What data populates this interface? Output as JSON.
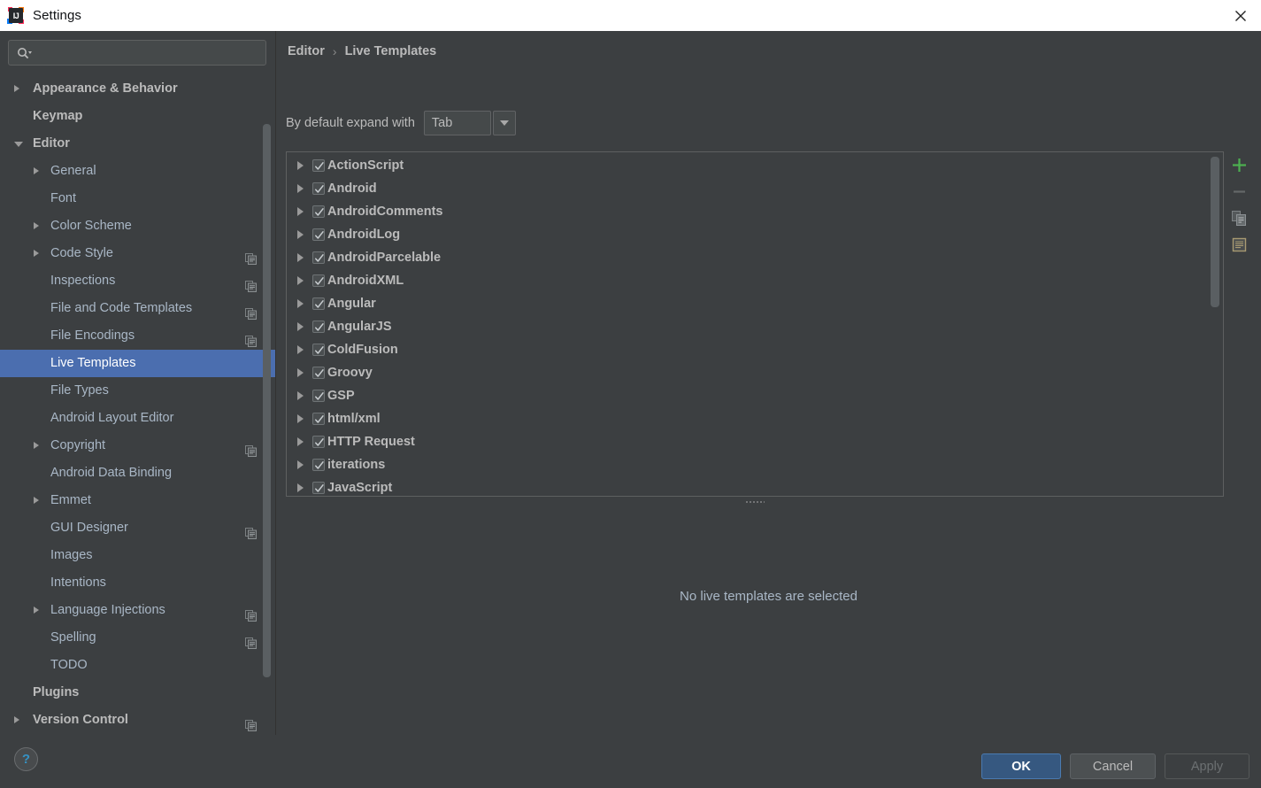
{
  "window": {
    "title": "Settings",
    "app_icon": "intellij-idea-logo",
    "icon_letters": "IJ",
    "close_icon": "close-icon"
  },
  "search": {
    "value": "",
    "placeholder": "",
    "icon": "search-icon"
  },
  "sidebar": {
    "items": [
      {
        "label": "Appearance & Behavior",
        "level": 0,
        "arrow": "collapsed",
        "bold": true,
        "copy_icon": false,
        "selected": false
      },
      {
        "label": "Keymap",
        "level": 0,
        "arrow": "none",
        "bold": true,
        "copy_icon": false,
        "selected": false
      },
      {
        "label": "Editor",
        "level": 0,
        "arrow": "expanded",
        "bold": true,
        "copy_icon": false,
        "selected": false
      },
      {
        "label": "General",
        "level": 1,
        "arrow": "collapsed",
        "bold": false,
        "copy_icon": false,
        "selected": false
      },
      {
        "label": "Font",
        "level": 1,
        "arrow": "none",
        "bold": false,
        "copy_icon": false,
        "selected": false
      },
      {
        "label": "Color Scheme",
        "level": 1,
        "arrow": "collapsed",
        "bold": false,
        "copy_icon": false,
        "selected": false
      },
      {
        "label": "Code Style",
        "level": 1,
        "arrow": "collapsed",
        "bold": false,
        "copy_icon": true,
        "selected": false
      },
      {
        "label": "Inspections",
        "level": 1,
        "arrow": "none",
        "bold": false,
        "copy_icon": true,
        "selected": false
      },
      {
        "label": "File and Code Templates",
        "level": 1,
        "arrow": "none",
        "bold": false,
        "copy_icon": true,
        "selected": false
      },
      {
        "label": "File Encodings",
        "level": 1,
        "arrow": "none",
        "bold": false,
        "copy_icon": true,
        "selected": false
      },
      {
        "label": "Live Templates",
        "level": 1,
        "arrow": "none",
        "bold": false,
        "copy_icon": false,
        "selected": true
      },
      {
        "label": "File Types",
        "level": 1,
        "arrow": "none",
        "bold": false,
        "copy_icon": false,
        "selected": false
      },
      {
        "label": "Android Layout Editor",
        "level": 1,
        "arrow": "none",
        "bold": false,
        "copy_icon": false,
        "selected": false
      },
      {
        "label": "Copyright",
        "level": 1,
        "arrow": "collapsed",
        "bold": false,
        "copy_icon": true,
        "selected": false
      },
      {
        "label": "Android Data Binding",
        "level": 1,
        "arrow": "none",
        "bold": false,
        "copy_icon": false,
        "selected": false
      },
      {
        "label": "Emmet",
        "level": 1,
        "arrow": "collapsed",
        "bold": false,
        "copy_icon": false,
        "selected": false
      },
      {
        "label": "GUI Designer",
        "level": 1,
        "arrow": "none",
        "bold": false,
        "copy_icon": true,
        "selected": false
      },
      {
        "label": "Images",
        "level": 1,
        "arrow": "none",
        "bold": false,
        "copy_icon": false,
        "selected": false
      },
      {
        "label": "Intentions",
        "level": 1,
        "arrow": "none",
        "bold": false,
        "copy_icon": false,
        "selected": false
      },
      {
        "label": "Language Injections",
        "level": 1,
        "arrow": "collapsed",
        "bold": false,
        "copy_icon": true,
        "selected": false
      },
      {
        "label": "Spelling",
        "level": 1,
        "arrow": "none",
        "bold": false,
        "copy_icon": true,
        "selected": false
      },
      {
        "label": "TODO",
        "level": 1,
        "arrow": "none",
        "bold": false,
        "copy_icon": false,
        "selected": false
      },
      {
        "label": "Plugins",
        "level": 0,
        "arrow": "none",
        "bold": true,
        "copy_icon": false,
        "selected": false
      },
      {
        "label": "Version Control",
        "level": 0,
        "arrow": "collapsed",
        "bold": true,
        "copy_icon": true,
        "selected": false
      }
    ]
  },
  "breadcrumb": {
    "parent": "Editor",
    "separator": "›",
    "current": "Live Templates"
  },
  "expand_with": {
    "label": "By default expand with",
    "value": "Tab",
    "dropdown_icon": "chevron-down-icon"
  },
  "templates": {
    "rows": [
      {
        "label": "ActionScript",
        "checked": true
      },
      {
        "label": "Android",
        "checked": true
      },
      {
        "label": "AndroidComments",
        "checked": true
      },
      {
        "label": "AndroidLog",
        "checked": true
      },
      {
        "label": "AndroidParcelable",
        "checked": true
      },
      {
        "label": "AndroidXML",
        "checked": true
      },
      {
        "label": "Angular",
        "checked": true
      },
      {
        "label": "AngularJS",
        "checked": true
      },
      {
        "label": "ColdFusion",
        "checked": true
      },
      {
        "label": "Groovy",
        "checked": true
      },
      {
        "label": "GSP",
        "checked": true
      },
      {
        "label": "html/xml",
        "checked": true
      },
      {
        "label": "HTTP Request",
        "checked": true
      },
      {
        "label": "iterations",
        "checked": true
      },
      {
        "label": "JavaScript",
        "checked": true
      }
    ]
  },
  "toolbar": {
    "buttons": [
      {
        "name": "add-button",
        "icon": "plus-icon",
        "color": "#4caf50",
        "enabled": true
      },
      {
        "name": "remove-button",
        "icon": "minus-icon",
        "color": "#6b6f71",
        "enabled": false
      },
      {
        "name": "duplicate-button",
        "icon": "copy-icon",
        "color": "#9aa0a3",
        "enabled": true
      },
      {
        "name": "edit-variables-button",
        "icon": "document-lines-icon",
        "color": "#a89a72",
        "enabled": true
      }
    ]
  },
  "splitter": {
    "icon": "splitter-grip-icon"
  },
  "empty_state": {
    "message": "No live templates are selected"
  },
  "footer": {
    "help_label": "?",
    "help_icon": "help-icon",
    "ok_label": "OK",
    "cancel_label": "Cancel",
    "apply_label": "Apply"
  },
  "colors": {
    "window_bg": "#3c3f41",
    "titlebar_bg": "#ffffff",
    "selection_blue": "#4b6eaf",
    "ok_button_blue": "#365880",
    "text": "#bbbbbb",
    "muted_text": "#a9b7c6",
    "accent_green": "#4caf50",
    "help_blue": "#3592c4"
  }
}
